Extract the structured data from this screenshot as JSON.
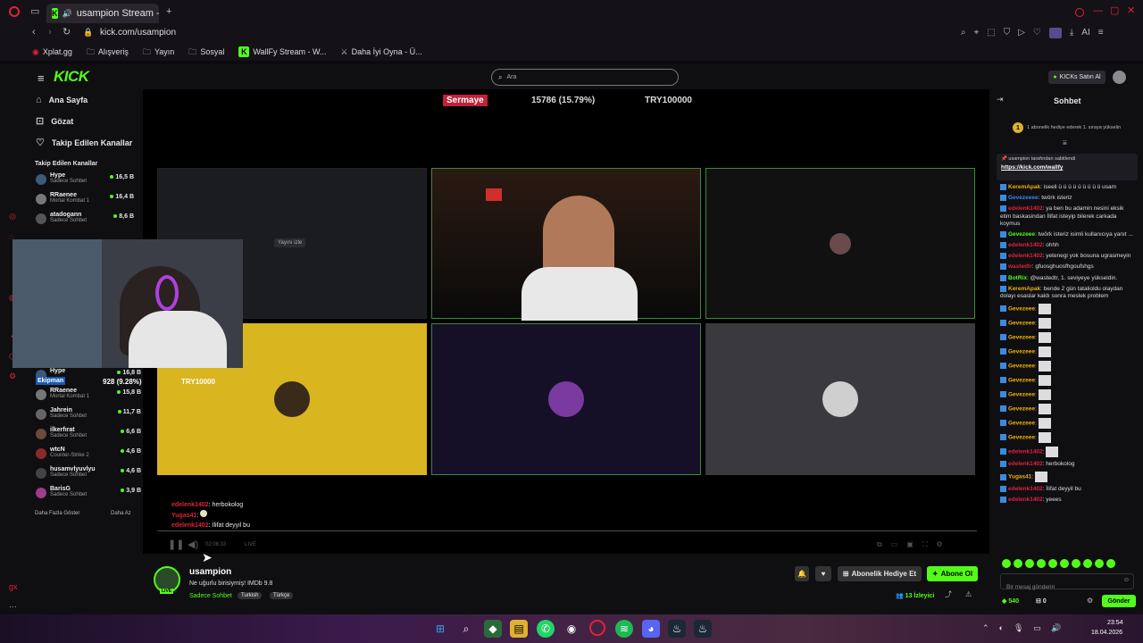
{
  "browser": {
    "tab_title": "usampion Stream - Wa",
    "url": "kick.com/usampion",
    "bookmarks": [
      "Xplat.gg",
      "Alışveriş",
      "Yayın",
      "Sosyal",
      "WallFy Stream - W...",
      "Daha İyi Oyna - Ü..."
    ]
  },
  "header": {
    "logo": "KICK",
    "search_placeholder": "Ara",
    "buy_kicks": "KICKs Satın Al"
  },
  "sidebar": {
    "nav": [
      {
        "label": "Ana Sayfa",
        "icon": "home-icon"
      },
      {
        "label": "Gözat",
        "icon": "browse-icon"
      },
      {
        "label": "Takip Edilen Kanallar",
        "icon": "heart-icon"
      }
    ],
    "followed_title": "Takip Edilen Kanallar",
    "channels_top": [
      {
        "name": "Hype",
        "sub": "Sadece Sohbet",
        "count": "16,5 B"
      },
      {
        "name": "RRaenee",
        "sub": "Mortal Kombat 1",
        "count": "16,4 B"
      },
      {
        "name": "atadogann",
        "sub": "Sadece Sohbet",
        "count": "8,6 B"
      }
    ],
    "channels_bottom": [
      {
        "name": "Hype",
        "sub": "",
        "count": "16,8 B"
      },
      {
        "name": "RRaenee",
        "sub": "Mortal Kombat 1",
        "count": "15,8 B"
      },
      {
        "name": "Jahrein",
        "sub": "Sadece Sohbet",
        "count": "11,7 B"
      },
      {
        "name": "ilkerfırat",
        "sub": "Sadece Sohbet",
        "count": "6,6 B"
      },
      {
        "name": "wtcN",
        "sub": "Counter-Strike 2",
        "count": "4,6 B"
      },
      {
        "name": "husamvlyuvlyu",
        "sub": "Sadece Sohbet",
        "count": "4,6 B"
      },
      {
        "name": "BarisG",
        "sub": "Sadece Sohbet",
        "count": "3,9 B"
      }
    ],
    "show_more": "Daha Fazla Göster",
    "show_less": "Daha Az"
  },
  "overlay": {
    "capital_label": "Sermaye",
    "capital_value": "15786 (15.79%)",
    "capital_goal": "TRY100000",
    "equip_label": "Ekipman",
    "equip_value": "928 (9.28%)",
    "equip_goal": "TRY10000",
    "watch_label": "Yayını izle"
  },
  "stream_chat_overlay": [
    {
      "user": "edelenk1402",
      "msg": "herbokolog"
    },
    {
      "user": "Yugas41",
      "msg": ""
    },
    {
      "user": "edelenk1402",
      "msg": "İlifat deyyil bu"
    }
  ],
  "player": {
    "time": "02:08:33",
    "live": "LIVE"
  },
  "channel": {
    "name": "usampion",
    "title": "Ne uğurlu birisiymiş! IMDb 9.8",
    "category": "Sadece Sohbet",
    "tags": [
      "Turkish",
      "Türkçe"
    ],
    "gift_sub": "Abonelik Hediye Et",
    "subscribe": "Abone Ol",
    "viewers": "13 İzleyici",
    "live_badge": "LIVE"
  },
  "chat": {
    "title": "Sohbet",
    "promo": "1 abonelik hediye ederek 1. sıraya yükselin",
    "pinned_by": "usampion tarafından sabitlendi",
    "pinned_link": "https://kick.com/wallfy",
    "messages": [
      {
        "user": "KeremApak",
        "color": "y",
        "msg": "iseeli ü ü ü ü ü ü ü ü ü usam"
      },
      {
        "user": "Gevezeeee",
        "color": "b",
        "msg": "twörk isteriz"
      },
      {
        "user": "edelenk1402",
        "color": "r",
        "msg": "ya ben bu adamin nesini eksik etim baskasindan İlifat isteyip bilerek carkada koymus"
      },
      {
        "user": "Gevezeee",
        "color": "g",
        "msg": "twörk isteriz isimli kullanıcıya yanıt ..."
      },
      {
        "user": "edelenk1402",
        "color": "r",
        "msg": "ohhh"
      },
      {
        "user": "edelenk1402",
        "color": "r",
        "msg": "yetenegi yok bosuna ugrasmeyin"
      },
      {
        "user": "wastedtr",
        "color": "r",
        "msg": "gfuosghuosfhgoufshgs"
      },
      {
        "user": "BotRix",
        "color": "g",
        "msg": "@wastedtr, 1. seviyeye yükseldin."
      },
      {
        "user": "KeremApak",
        "color": "y",
        "msg": "bende 2 gün tatalioldu olaydan dolayı esaslar kaldı sonra meslek problem"
      },
      {
        "user": "Gevezeee",
        "color": "y",
        "msg": ""
      },
      {
        "user": "Gevezeee",
        "color": "y",
        "msg": ""
      },
      {
        "user": "Gevezeee",
        "color": "y",
        "msg": ""
      },
      {
        "user": "Gevezeee",
        "color": "y",
        "msg": ""
      },
      {
        "user": "Gevezeee",
        "color": "y",
        "msg": ""
      },
      {
        "user": "Gevezeee",
        "color": "y",
        "msg": ""
      },
      {
        "user": "Gevezeee",
        "color": "y",
        "msg": ""
      },
      {
        "user": "Gevezeee",
        "color": "y",
        "msg": ""
      },
      {
        "user": "Gevezeee",
        "color": "y",
        "msg": ""
      },
      {
        "user": "Gevezeee",
        "color": "y",
        "msg": ""
      },
      {
        "user": "edelenk1402",
        "color": "r",
        "msg": ""
      },
      {
        "user": "edelenk1402",
        "color": "r",
        "msg": "herbokolog"
      },
      {
        "user": "Yugas41",
        "color": "y",
        "msg": ""
      },
      {
        "user": "edelenk1402",
        "color": "r",
        "msg": "İlifat deyyil bu"
      },
      {
        "user": "edelenk1402",
        "color": "r",
        "msg": "yeees"
      }
    ],
    "input_placeholder": "Bir mesaj gönderin",
    "kicks_count": "540",
    "points": "0",
    "send": "Gönder"
  },
  "taskbar": {
    "time": "23:54",
    "date": "18.04.2026"
  }
}
